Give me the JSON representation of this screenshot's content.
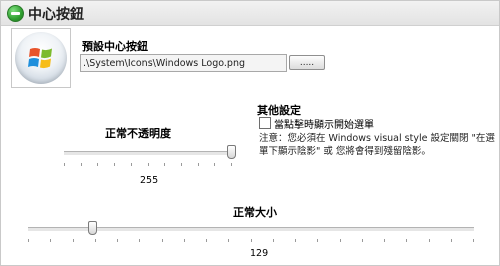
{
  "header": {
    "title": "中心按鈕",
    "icon": "minus-circle-icon"
  },
  "default_button": {
    "label": "預設中心按鈕",
    "image_icon": "windows-start-orb-icon",
    "path_value": ".\\System\\Icons\\Windows Logo.png",
    "browse_label": "....."
  },
  "other_settings": {
    "label": "其他設定",
    "checkbox_label": "當點擊時顯示開始選單",
    "checkbox_checked": false,
    "note": "注意：您必須在 Windows visual style 設定關閉 \"在選單下顯示陰影\" 或 您將會得到殘留陰影。"
  },
  "normal_opacity": {
    "label": "正常不透明度",
    "value": "255",
    "min": 0,
    "max": 255,
    "current": 255
  },
  "normal_size": {
    "label": "正常大小",
    "value": "129",
    "min": 100,
    "max": 300,
    "current": 129
  }
}
